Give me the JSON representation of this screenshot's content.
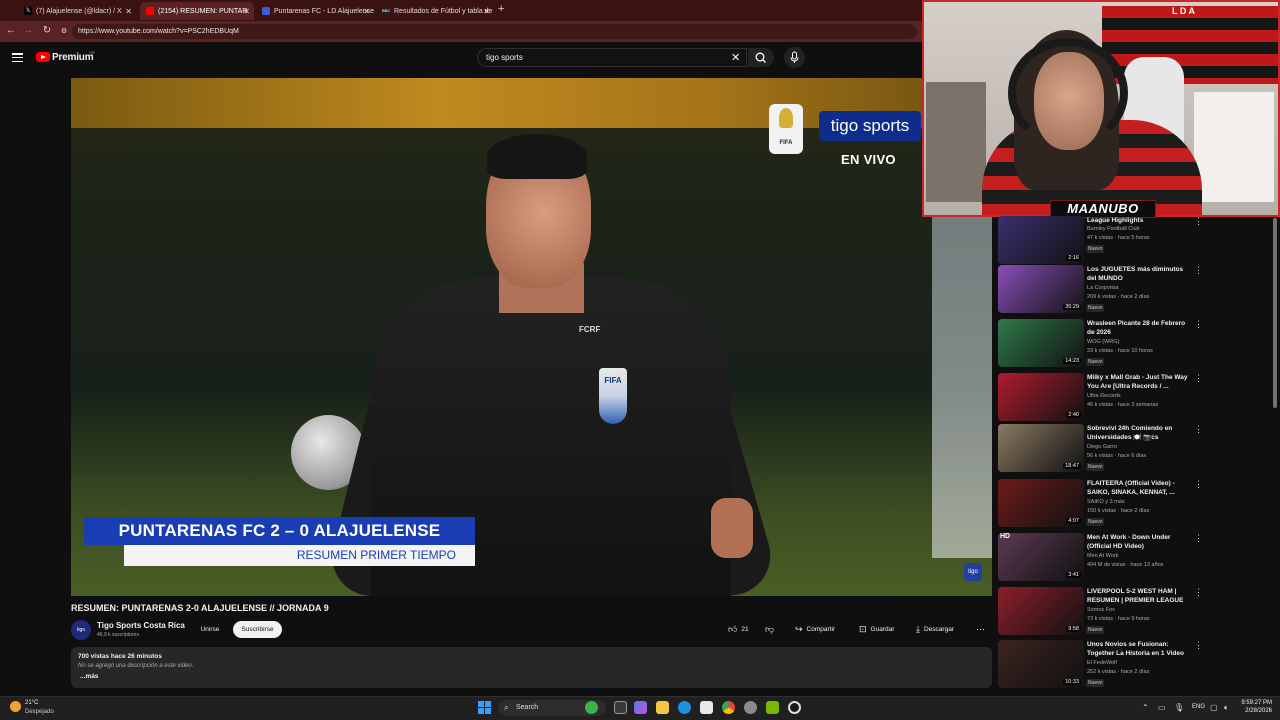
{
  "browser": {
    "tabs": [
      {
        "label": "(7) Alajuelense (@ldacr) / X",
        "icon": "x-icon"
      },
      {
        "label": "(2154) RESUMEN: PUNTAR",
        "icon": "youtube-icon",
        "active": true
      },
      {
        "label": "Puntarenas FC - LD Alajuelense",
        "icon": "sofascore-icon"
      },
      {
        "label": "Resultados de Fútbol y tabla de",
        "icon": "bbc-icon"
      }
    ],
    "new_tab": "+",
    "url": "https://www.youtube.com/watch?v=PSC2hEDBUqM"
  },
  "youtube": {
    "brand": "Premium",
    "country": "CR",
    "search_value": "tigo sports",
    "clear_symbol": "✕"
  },
  "video": {
    "overlay": {
      "score_line": "PUNTARENAS FC  2 – 0 ALAJUELENSE",
      "score_sub": "RESUMEN PRIMER TIEMPO",
      "broadcaster": "tigo sports",
      "live_label": "EN VIVO",
      "fifa_badge": "FIFA",
      "referee_badge": "FIFA",
      "kit_brand": "FCRF",
      "watermark": "tigo"
    },
    "title": "RESUMEN: PUNTARENAS 2-0 ALAJUELENSE // JORNADA 9",
    "channel": {
      "name": "Tigo Sports Costa Rica",
      "subscribers": "46,9 k suscriptores",
      "avatar_text": "tigo"
    },
    "join_label": "Unirse",
    "subscribe_label": "Suscribirse",
    "likes": "21",
    "share_label": "Compartir",
    "save_label": "Guardar",
    "download_label": "Descargar",
    "description": {
      "stats": "700 vistas  hace 26 minutos",
      "text": "No se agregó una descripción a este video.",
      "more": "...más"
    }
  },
  "stream": {
    "nameplate": "MAANUBO",
    "flag_text": "L D A"
  },
  "sidebar": {
    "items": [
      {
        "title": "League Highlights",
        "channel": "Burnley Football Club",
        "meta": "47 k vistas · hace 5 horas",
        "badge": "Nuevo",
        "duration": "2:16",
        "color": "#3a2e6e"
      },
      {
        "title": "Los JUGUETES más diminutos del MUNDO",
        "channel": "La Corporisa",
        "meta": "209 k vistas · hace 2 días",
        "badge": "Nuevo",
        "duration": "35:29",
        "color": "#8a4fb8"
      },
      {
        "title": "Wrasleen Picante 28 de Febrero de 2026",
        "channel": "WOG (WRG)",
        "meta": "23 k vistas · hace 10 horas",
        "badge": "Nuevo",
        "duration": "14:23",
        "color": "#2f7a4a"
      },
      {
        "title": "Milky x Mall Grab - Just The Way You Are [Ultra Records / ...",
        "channel": "Ultra Records",
        "meta": "46 k vistas · hace 3 semanas",
        "badge": "",
        "duration": "2:40",
        "color": "#b01c2e"
      },
      {
        "title": "Sobreviví 24h Comiendo en Universidades 🍽️ 📷cs",
        "channel": "Diego Garro",
        "meta": "56 k vistas · hace 6 días",
        "badge": "Nuevo",
        "duration": "18:47",
        "color": "#8a7a64"
      },
      {
        "title": "FLAITEERA (Official Video) - SAIKO, SINAKA, KENNAT, ...",
        "channel": "SAIKO y 3 más",
        "meta": "150 k vistas · hace 2 días",
        "badge": "Nuevo",
        "duration": "4:07",
        "color": "#6e1a1a"
      },
      {
        "title": "Men At Work - Down Under (Official HD Video)",
        "channel": "Men At Work",
        "meta": "494 M de vistas · hace 13 años",
        "badge": "",
        "duration": "3:41",
        "color": "#5c3a52"
      },
      {
        "title": "LIVERPOOL 5-2 WEST HAM | RESUMEN | PREMIER LEAGUE ...",
        "channel": "Somos Fox",
        "meta": "73 k vistas · hace 9 horas",
        "badge": "Nuevo",
        "duration": "9:58",
        "color": "#8c1f2c"
      },
      {
        "title": "Unos Novios se Fusionan: Together La Historia en 1 Video",
        "channel": "El FedeWolf",
        "meta": "252 k vistas · hace 2 días",
        "badge": "Nuevo",
        "duration": "10:33",
        "color": "#3b2420"
      }
    ]
  },
  "taskbar": {
    "temperature": "21°C",
    "condition": "Despejado",
    "search_label": "Search",
    "language": "ENG",
    "time": "9:59:27 PM",
    "date": "2/28/2026"
  }
}
